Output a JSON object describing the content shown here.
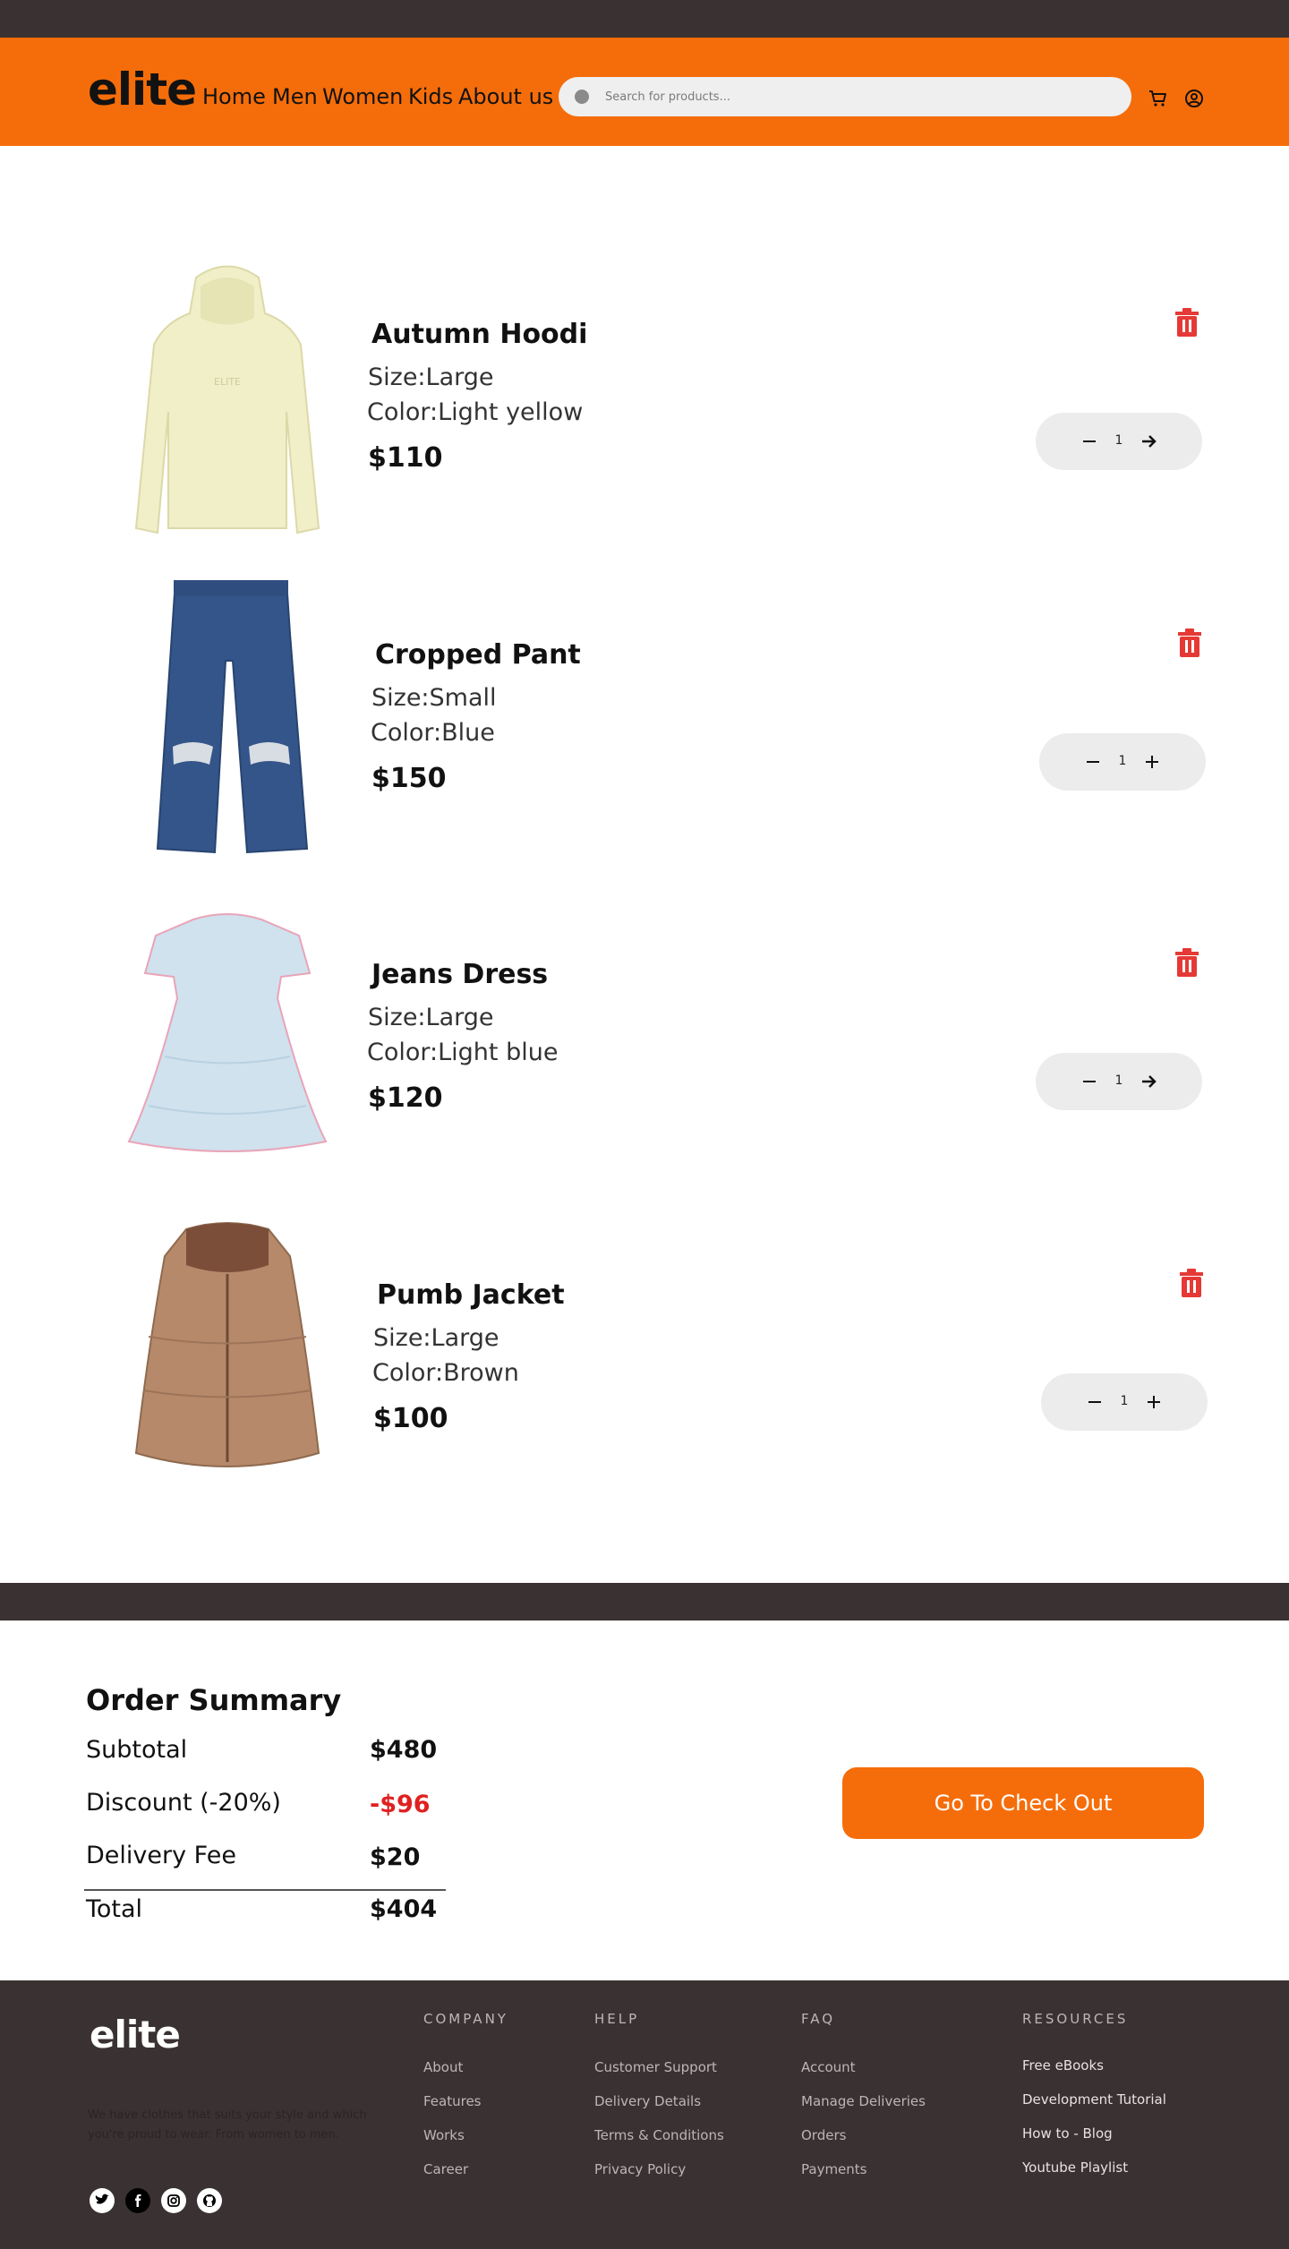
{
  "header": {
    "logo": "elite",
    "nav": [
      "Home",
      "Men",
      "Women",
      "Kids",
      "About us"
    ],
    "search_placeholder": "Search for products...",
    "icons": [
      "search-icon",
      "cart-icon",
      "user-icon"
    ]
  },
  "cart": {
    "items": [
      {
        "name": "Autumn Hoodi",
        "size": "Size:Large",
        "color": "Color:Light yellow",
        "price": "$110",
        "quantity": "1",
        "image": "hoodie-image",
        "hex": "#f1efc8"
      },
      {
        "name": "Cropped Pant",
        "size": "Size:Small",
        "color": "Color:Blue",
        "price": "$150",
        "quantity": "1",
        "image": "jeans-image",
        "hex": "#34558a"
      },
      {
        "name": "Jeans Dress",
        "size": "Size:Large",
        "color": "Color:Light blue",
        "price": "$120",
        "quantity": "1",
        "image": "dress-image",
        "hex": "#cfe2ee"
      },
      {
        "name": "Pumb Jacket",
        "size": "Size:Large",
        "color": "Color:Brown",
        "price": "$100",
        "quantity": "1",
        "image": "vest-image",
        "hex": "#b6896a"
      }
    ]
  },
  "summary": {
    "title": "Order Summary",
    "rows": [
      {
        "label": "Subtotal",
        "value": "$480"
      },
      {
        "label": "Discount (-20%)",
        "value": "-$96"
      },
      {
        "label": "Delivery Fee",
        "value": "$20"
      },
      {
        "label": "Total",
        "value": "$404"
      }
    ],
    "checkout_label": "Go To Check Out"
  },
  "footer": {
    "logo": "elite",
    "tagline": "We have clothes that suits your style and which you're proud to wear. From women to men.",
    "columns": [
      {
        "title": "COMPANY",
        "links": [
          "About",
          "Features",
          "Works",
          "Career"
        ]
      },
      {
        "title": "HELP",
        "links": [
          "Customer Support",
          "Delivery Details",
          "Terms & Conditions",
          "Privacy Policy"
        ]
      },
      {
        "title": "FAQ",
        "links": [
          "Account",
          "Manage Deliveries",
          "Orders",
          "Payments"
        ]
      },
      {
        "title": "RESOURCES",
        "links": [
          "Free eBooks",
          "Development Tutorial",
          "How to - Blog",
          "Youtube Playlist"
        ]
      }
    ],
    "social": [
      "twitter-icon",
      "facebook-icon",
      "instagram-icon",
      "github-icon"
    ]
  },
  "colors": {
    "accent": "#f56d0a",
    "dark": "#3a3232",
    "danger": "#e53935",
    "discount": "#e02020"
  }
}
